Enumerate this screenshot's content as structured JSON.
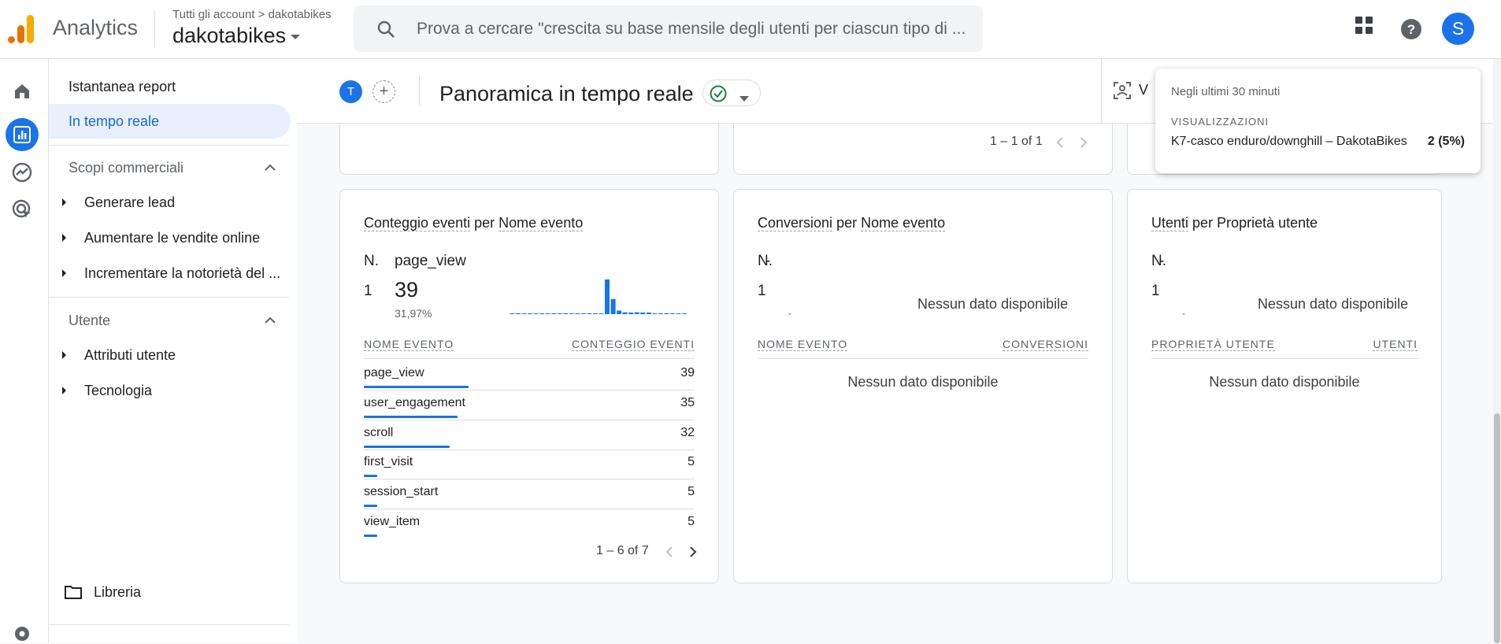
{
  "header": {
    "app_name": "Analytics",
    "breadcrumb": "Tutti gli account > dakotabikes",
    "property_name": "dakotabikes",
    "search_placeholder": "Prova a cercare \"crescita su base mensile degli utenti per ciascun tipo di ...",
    "avatar_letter": "S"
  },
  "sidebar": {
    "snapshot": "Istantanea report",
    "realtime": "In tempo reale",
    "section_business": "Scopi commerciali",
    "business_items": [
      "Generare lead",
      "Aumentare le vendite online",
      "Incrementare la notorietà del ..."
    ],
    "section_user": "Utente",
    "user_items": [
      "Attributi utente",
      "Tecnologia"
    ],
    "library": "Libreria"
  },
  "toolbar": {
    "comparison_chip": "T",
    "add_comparison": "+",
    "page_title": "Panoramica in tempo reale",
    "view_label_partial": "V"
  },
  "top_cards": {
    "middle_pager": "1 – 1 of 1"
  },
  "events_card": {
    "title_metric": "Conteggio eventi",
    "title_per": "per",
    "title_dimension": "Nome evento",
    "n_label": "N.",
    "top_name": "page_view",
    "rank": "1",
    "top_value": "39",
    "top_pct": "31,97%",
    "col_name": "NOME EVENTO",
    "col_value": "CONTEGGIO EVENTI",
    "rows": [
      {
        "name": "page_view",
        "value": "39",
        "share": 1.0
      },
      {
        "name": "user_engagement",
        "value": "35",
        "share": 0.897
      },
      {
        "name": "scroll",
        "value": "32",
        "share": 0.82
      },
      {
        "name": "first_visit",
        "value": "5",
        "share": 0.128
      },
      {
        "name": "session_start",
        "value": "5",
        "share": 0.128
      },
      {
        "name": "view_item",
        "value": "5",
        "share": 0.128
      }
    ],
    "pager": "1 – 6 of 7",
    "sparkline": [
      0,
      0,
      0,
      0,
      0,
      0,
      0,
      0,
      0,
      0,
      0,
      0,
      0,
      0,
      0,
      0,
      39,
      17,
      4,
      2,
      1,
      2,
      1,
      1,
      0,
      0,
      0,
      0,
      0,
      0
    ]
  },
  "conversions_card": {
    "title_metric": "Conversioni",
    "title_per": "per",
    "title_dimension": "Nome evento",
    "n_label": "N.",
    "n_name": "-",
    "rank": "1",
    "small_dash": "-",
    "no_data": "Nessun dato disponibile",
    "col_name": "NOME EVENTO",
    "col_value": "CONVERSIONI",
    "table_no_data": "Nessun dato disponibile"
  },
  "users_card": {
    "title_metric": "Utenti",
    "title_per": "per",
    "title_dimension": "Proprietà utente",
    "n_label": "N.",
    "n_name": "-",
    "rank": "1",
    "small_dash": "-",
    "no_data": "Nessun dato disponibile",
    "col_name": "PROPRIETÀ UTENTE",
    "col_value": "UTENTI",
    "table_no_data": "Nessun dato disponibile"
  },
  "tooltip": {
    "heading": "Negli ultimi 30 minuti",
    "metric_label": "VISUALIZZAZIONI",
    "page": "K7-casco enduro/downghill – DakotaBikes",
    "value": "2 (5%)"
  },
  "colors": {
    "accent": "#1a73e8",
    "success": "#188038"
  }
}
